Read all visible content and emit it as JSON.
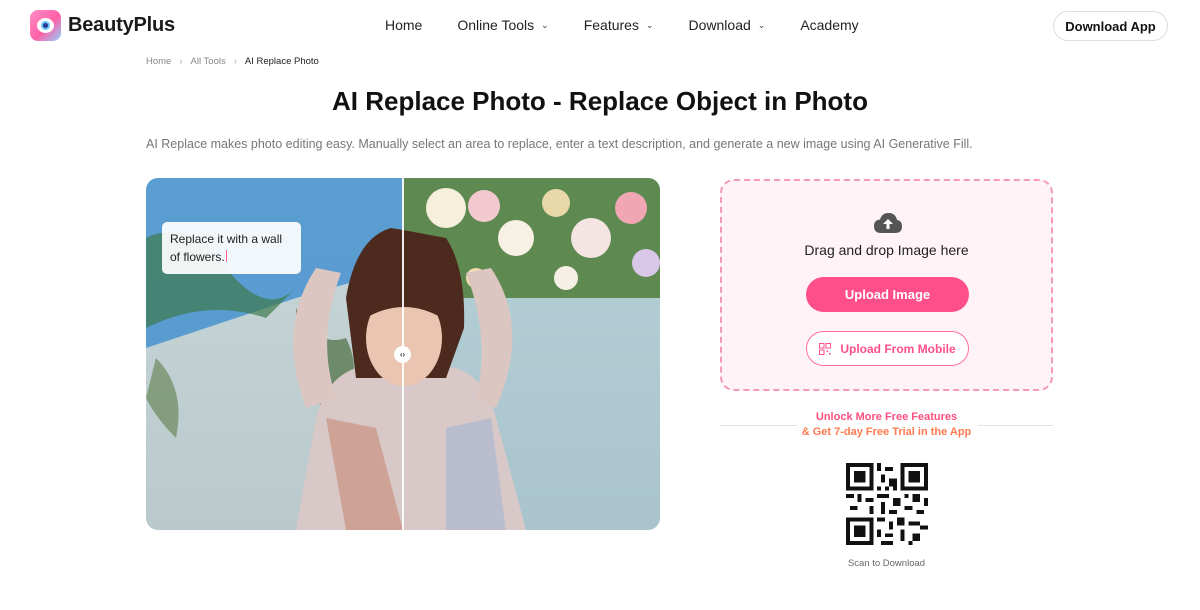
{
  "brand": {
    "name": "BeautyPlus"
  },
  "nav": {
    "items": [
      {
        "label": "Home",
        "has_menu": false
      },
      {
        "label": "Online Tools",
        "has_menu": true
      },
      {
        "label": "Features",
        "has_menu": true
      },
      {
        "label": "Download",
        "has_menu": true
      },
      {
        "label": "Academy",
        "has_menu": false
      }
    ],
    "download_app": "Download App"
  },
  "breadcrumb": {
    "items": [
      "Home",
      "All Tools",
      "AI Replace Photo"
    ]
  },
  "page": {
    "title": "AI Replace Photo - Replace Object in Photo",
    "description": "AI Replace makes photo editing easy. Manually select an area to replace, enter a text description, and generate a new image using AI Generative Fill."
  },
  "demo": {
    "caption": "Replace it with a wall of flowers.",
    "slider_icon": "‹›"
  },
  "upload": {
    "drag_text": "Drag and drop Image here",
    "upload_button": "Upload Image",
    "mobile_button": "Upload From Mobile",
    "icon": "cloud-upload-icon"
  },
  "promo": {
    "line1": "Unlock More Free Features",
    "line2": "& Get 7-day Free Trial in the App"
  },
  "qr": {
    "label": "Scan to Download"
  },
  "colors": {
    "accent": "#ff4f8b",
    "upload_bg": "#fff3f7",
    "dashed_border": "#f39ab5",
    "promo_orange": "#ff7a4f"
  }
}
